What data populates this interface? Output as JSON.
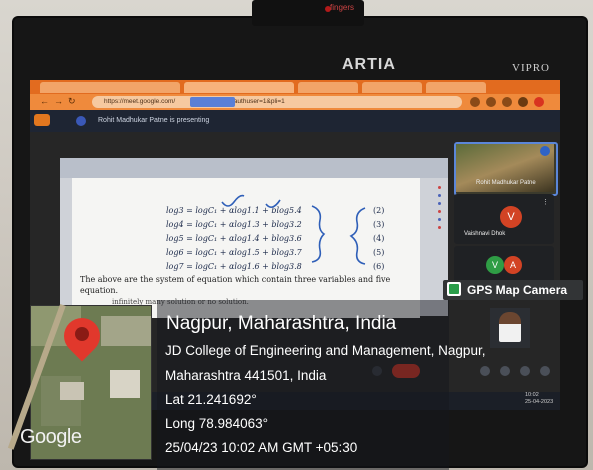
{
  "monitor": {
    "brand": "VIPRO",
    "case_text": "ARTIA",
    "webcam_label": "fingers"
  },
  "browser": {
    "url": "https://meet.google.com/",
    "url_suffix": "?authuser=1&pli=1"
  },
  "meet": {
    "presenting_text": "Rohit Madhukar Patne is presenting",
    "participants": [
      {
        "name": "Rohit Madhukar Patne",
        "initials": ""
      },
      {
        "name": "Vaishnavi Dhok",
        "initials": "V"
      },
      {
        "name": "",
        "initials": "V"
      },
      {
        "name": "",
        "initials": "A"
      }
    ],
    "tray_time": "10:02",
    "tray_date": "25-04-2023"
  },
  "document": {
    "equations": [
      {
        "text": "log3 = logC₁ + αlog1.1 + blog5.4",
        "no": "(2)"
      },
      {
        "text": "log4 = logC₁ + αlog1.3 + blog3.2",
        "no": "(3)"
      },
      {
        "text": "log5 = logC₁ + αlog1.4 + blog3.6",
        "no": "(4)"
      },
      {
        "text": "log6 = logC₁ + αlog1.5 + blog3.7",
        "no": "(5)"
      },
      {
        "text": "log7 = logC₁ + αlog1.6 + blog3.8",
        "no": "(6)"
      }
    ],
    "paragraph": "The above are the system of equation which contain three variables and five equation.",
    "paragraph2": "infinitely many solution or no solution."
  },
  "gps": {
    "badge": "GPS Map Camera",
    "place": "Nagpur, Maharashtra, India",
    "address_line1": "JD College of Engineering and Management, Nagpur,",
    "address_line2": "Maharashtra 441501, India",
    "lat": "Lat 21.241692°",
    "long": "Long 78.984063°",
    "datetime": "25/04/23 10:02 AM GMT +05:30",
    "map_brand": "Google"
  },
  "colors": {
    "chrome_orange": "#e26b1f",
    "gps_green": "#2a9d4a",
    "pin_red": "#e1382c",
    "end_call_red": "#d33526"
  }
}
